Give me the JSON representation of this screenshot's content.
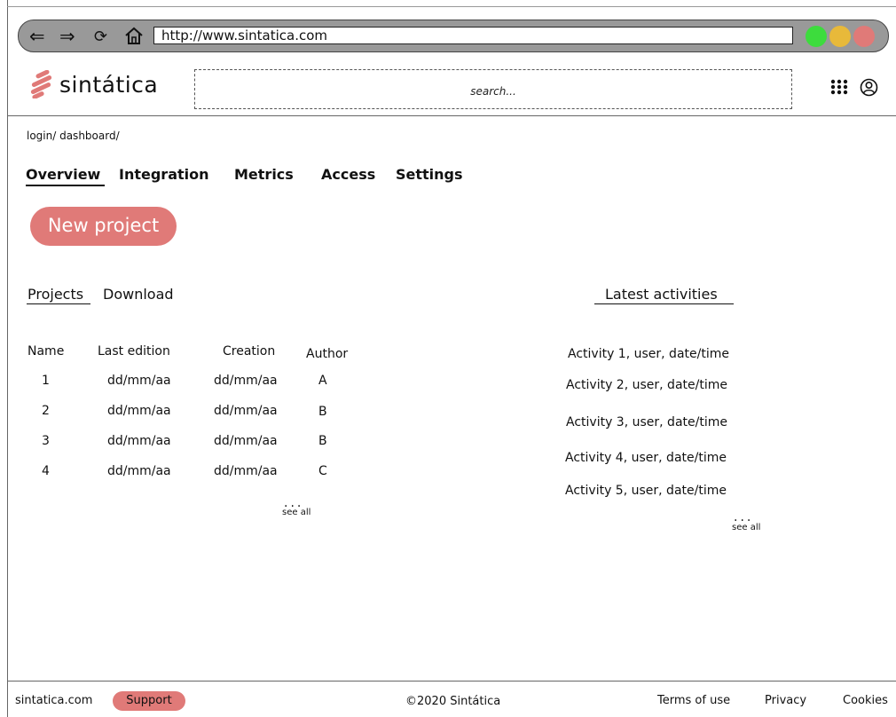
{
  "browser": {
    "url": "http://www.sintatica.com",
    "back_icon": "⇐",
    "forward_icon": "⇒",
    "reload_icon": "⟳",
    "home_icon": "⌂",
    "dots": [
      "#3ddc3d",
      "#e8b93a",
      "#e07a78"
    ]
  },
  "header": {
    "logo_text": "sintática",
    "search_placeholder": "search...",
    "apps_icon": "apps-grid-icon",
    "user_icon": "user-circle-icon"
  },
  "breadcrumb": "login/ dashboard/",
  "tabs": [
    "Overview",
    "Integration",
    "Metrics",
    "Access",
    "Settings"
  ],
  "new_project_label": "New project",
  "projects": {
    "subtabs": [
      "Projects",
      "Download"
    ],
    "columns": [
      "Name",
      "Last edition",
      "Creation",
      "Author"
    ],
    "rows": [
      [
        "1",
        "dd/mm/aa",
        "dd/mm/aa",
        "A"
      ],
      [
        "2",
        "dd/mm/aa",
        "dd/mm/aa",
        "B"
      ],
      [
        "3",
        "dd/mm/aa",
        "dd/mm/aa",
        "B"
      ],
      [
        "4",
        "dd/mm/aa",
        "dd/mm/aa",
        "C"
      ]
    ],
    "see_all_dots": "...",
    "see_all_label": "see all"
  },
  "activities": {
    "title": "Latest activities",
    "items": [
      "Activity 1, user, date/time",
      "Activity 2, user, date/time",
      "Activity 3, user, date/time",
      "Activity 4, user, date/time",
      "Activity 5, user, date/time"
    ],
    "see_all_dots": "...",
    "see_all_label": "see all"
  },
  "footer": {
    "site": "sintatica.com",
    "support_label": "Support",
    "copyright": "©2020 Sintática",
    "links": [
      "Terms of use",
      "Privacy",
      "Cookies"
    ]
  },
  "colors": {
    "accent": "#e07a78",
    "browser_bar": "#999999"
  }
}
